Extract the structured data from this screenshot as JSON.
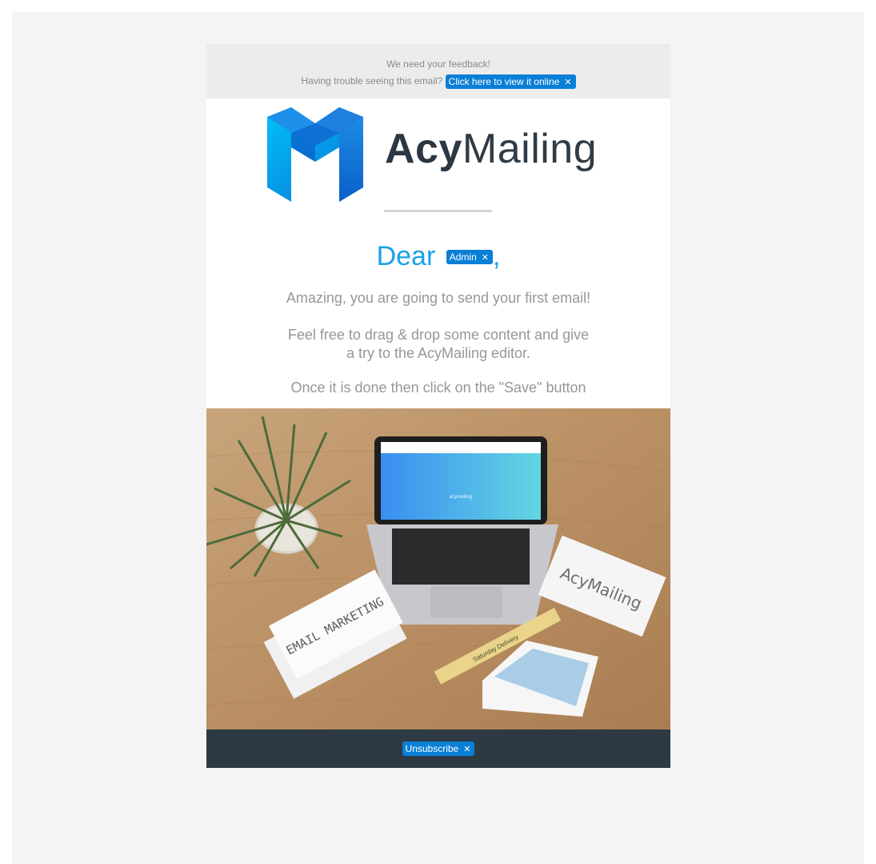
{
  "preheader": {
    "feedback_text": "We need your feedback!",
    "trouble_text": "Having trouble seeing this email?",
    "view_online_label": "Click here to view it online"
  },
  "logo": {
    "brand_part1": "Acy",
    "brand_part2": "Mailing"
  },
  "greeting": {
    "dear_text": "Dear",
    "name_tag": "Admin",
    "comma": ","
  },
  "content": {
    "paragraph1": "Amazing, you are going to send your first email!",
    "paragraph2_line1": "Feel free to drag & drop some content and give",
    "paragraph2_line2": "a try to the AcyMailing editor.",
    "paragraph3": "Once it is done then click on the \"Save\" button"
  },
  "photo": {
    "card_right_text": "AcyMailing",
    "card_left_text": "EMAIL MARKETING",
    "tape_text": "Saturday Delivery",
    "screen_brand": "acymailing"
  },
  "footer": {
    "unsubscribe_label": "Unsubscribe"
  },
  "icons": {
    "tag_remove": "close-icon",
    "logo": "acymailing-logo-icon"
  },
  "colors": {
    "tag_bg": "#0a7fd6",
    "greeting": "#1aa1e8",
    "footer_bg": "#2d3a44",
    "preheader_bg": "#ececec"
  }
}
